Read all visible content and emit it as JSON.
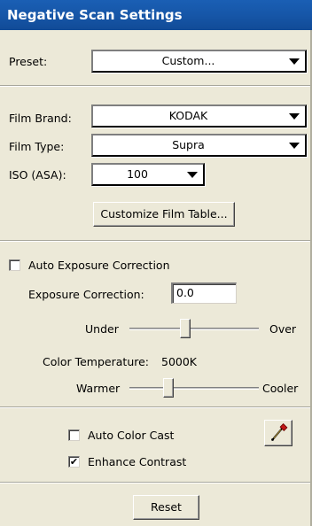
{
  "window": {
    "title": "Negative Scan Settings"
  },
  "preset": {
    "label": "Preset:",
    "value": "Custom..."
  },
  "film": {
    "brand_label": "Film Brand:",
    "brand_value": "KODAK",
    "type_label": "Film Type:",
    "type_value": "Supra",
    "iso_label": "ISO (ASA):",
    "iso_value": "100",
    "customize_button": "Customize Film Table..."
  },
  "exposure": {
    "auto_label": "Auto Exposure Correction",
    "auto_checked": false,
    "correction_label": "Exposure Correction:",
    "correction_value": "0.0",
    "under_label": "Under",
    "over_label": "Over",
    "slider_level": 0.43
  },
  "color_temp": {
    "label": "Color Temperature:",
    "value": "5000K",
    "warmer_label": "Warmer",
    "cooler_label": "Cooler",
    "slider_level": 0.3
  },
  "options": {
    "auto_color_cast_label": "Auto Color Cast",
    "auto_color_cast_checked": false,
    "enhance_contrast_label": "Enhance Contrast",
    "enhance_contrast_checked": true,
    "picker_icon": "eyedropper-icon"
  },
  "footer": {
    "reset_button": "Reset"
  },
  "colors": {
    "title_bar": "#1656a8",
    "panel": "#ece9d8"
  }
}
